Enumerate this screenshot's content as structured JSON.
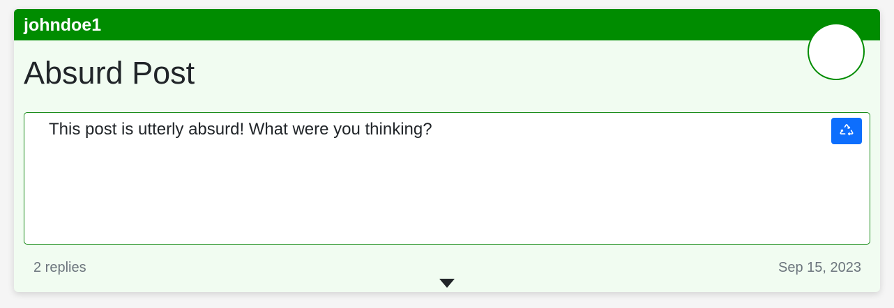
{
  "post": {
    "username": "johndoe1",
    "title": "Absurd Post",
    "body": "This post is utterly absurd! What were you thinking?",
    "replies": "2 replies",
    "date": "Sep 15, 2023"
  },
  "icons": {
    "recycle": "recycle-icon",
    "expand": "caret-down-icon"
  },
  "colors": {
    "header": "#008c00",
    "card_bg": "#f1fcf1",
    "button": "#0d6efd",
    "muted_text": "#6c757d",
    "text": "#212529"
  }
}
